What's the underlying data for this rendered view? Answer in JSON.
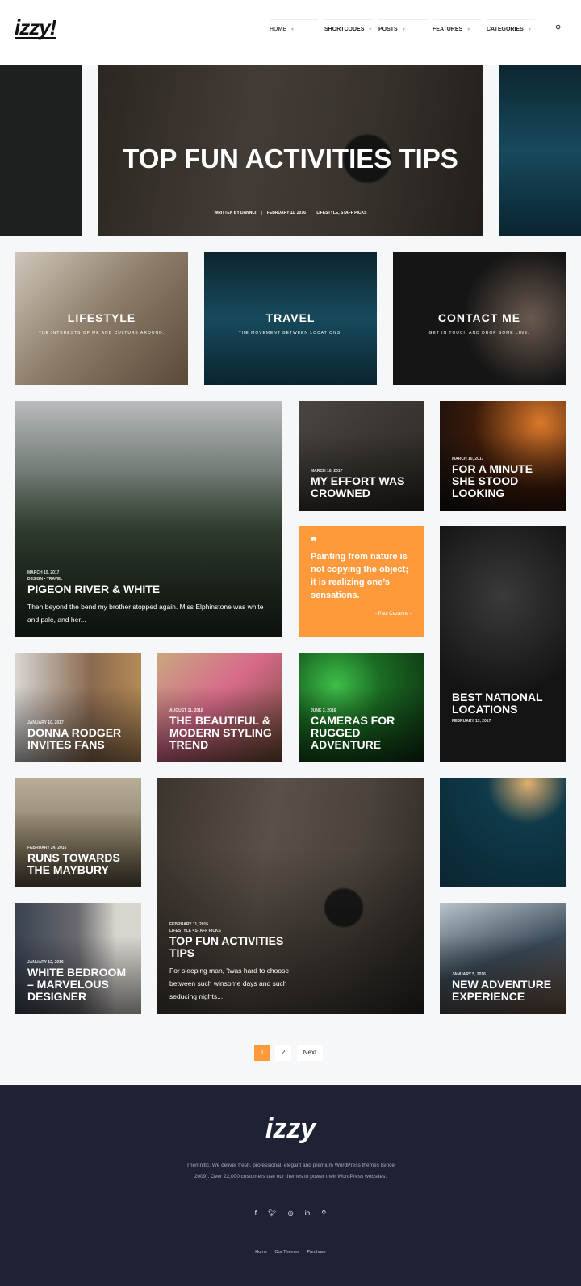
{
  "header": {
    "logo": "izzy!",
    "nav": [
      {
        "label": "HOME"
      },
      {
        "label": "SHORTCODES"
      },
      {
        "label": "POSTS"
      },
      {
        "label": "FEATURES"
      },
      {
        "label": "CATEGORIES"
      }
    ],
    "search_icon": "search-icon"
  },
  "slider": {
    "title": "TOP FUN ACTIVITIES TIPS",
    "author": "WRITTEN BY DANNCI",
    "date": "FEBRUARY 11, 2016",
    "categories": "LIFESTYLE, STAFF PICKS"
  },
  "categories": [
    {
      "title": "LIFESTYLE",
      "subtitle": "THE INTERESTS OF ME AND CULTURE AROUND."
    },
    {
      "title": "TRAVEL",
      "subtitle": "THE MOVEMENT BETWEEN LOCATIONS."
    },
    {
      "title": "CONTACT ME",
      "subtitle": "GET IN TOUCH AND DROP SOME LINE."
    }
  ],
  "posts": [
    {
      "date": "MARCH 15, 2017",
      "cats": "DESIGN • TRAVEL",
      "title": "Pigeon River & White",
      "excerpt": "Then beyond the bend my brother stopped again. Miss Elphinstone was white and pale, and her..."
    },
    {
      "date": "MARCH 10, 2017",
      "title": "My Effort Was Crowned"
    },
    {
      "date": "MARCH 10, 2017",
      "title": "For a Minute She Stood Looking"
    },
    {
      "title": "Best National Locations",
      "date": "FEBRUARY 13, 2017"
    },
    {
      "date": "JANUARY 10, 2017",
      "title": "Donna Rodger Invites Fans"
    },
    {
      "date": "AUGUST 11, 2016",
      "title": "The Beautiful & Modern Styling Trend"
    },
    {
      "date": "JUNE 3, 2016",
      "title": "Cameras for Rugged Adventure"
    },
    {
      "date": "FEBRUARY 24, 2016",
      "title": "Runs Towards the Maybury"
    },
    {
      "date": "FEBRUARY 11, 2016",
      "cats": "LIFESTYLE • STAFF PICKS",
      "title": "Top Fun Activities Tips",
      "excerpt": "For sleeping man, 'twas hard to choose between such winsome days and such seducing nights..."
    },
    {
      "date": "JANUARY 12, 2016",
      "title": "White Bedroom – Marvelous Designer"
    },
    {
      "date": "JANUARY 5, 2016",
      "title": "New Adventure Experience"
    }
  ],
  "quote": {
    "text": "Painting from nature is not copying the object; it is realizing one’s sensations.",
    "author": "- Paul Cezanne -"
  },
  "pagination": {
    "current": "1",
    "pages": [
      "1",
      "2"
    ],
    "next": "Next",
    "accent": "#ff9a3c"
  },
  "footer": {
    "logo": "izzy",
    "description": "Themnific. We deliver fresh, professional, elegant and premium WordPress themes (since 2009). Over 22,000 customers use our themes to power their WordPress websites.",
    "social": [
      "facebook-icon",
      "twitter-icon",
      "instagram-icon",
      "linkedin-icon",
      "search-icon"
    ],
    "links": [
      "Home",
      "Our Themes",
      "Purchase"
    ],
    "background": "#1f2235"
  }
}
